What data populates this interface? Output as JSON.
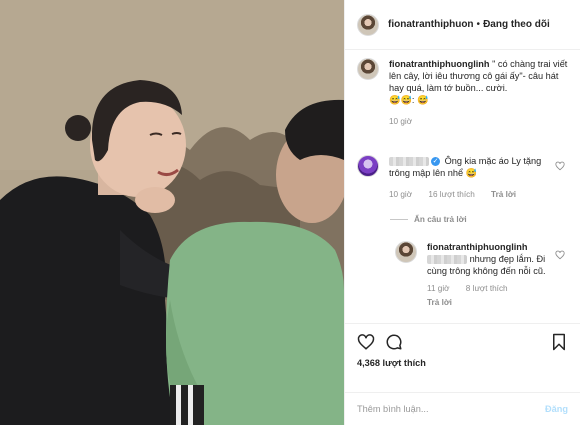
{
  "header": {
    "username": "fionatranthiphuon",
    "separator": "•",
    "follow_status": "Đang theo dõi"
  },
  "caption": {
    "username": "fionatranthiphuonglinh",
    "text": " \" có chàng trai viết lên cây, lời iêu thương cô gái ấy\"- câu hát hay quá, làm tớ buồn... cười.",
    "emoji_line": "😅😅: 😅",
    "time": "10 giờ"
  },
  "comment1": {
    "text": "Ông kia mặc áo Ly tặng trông mập lên nhể 😅",
    "time": "10 giờ",
    "likes": "16 lượt thích",
    "reply": "Trả lời",
    "hide_replies": "Ẩn câu trả lời"
  },
  "reply1": {
    "username": "fionatranthiphuonglinh",
    "text": "nhưng đẹp lắm. Đi cùng trông không đến nỗi cũ.",
    "time": "11 giờ",
    "likes": "8 lượt thích",
    "reply": "Trả lời"
  },
  "actions": {
    "likes_count": "4,368 lượt thích"
  },
  "add_comment": {
    "placeholder": "Thêm bình luận...",
    "post_label": "Đăng"
  },
  "colors": {
    "verified": "#3897f0",
    "muted": "#8e8e8e",
    "post_disabled": "#b2dffc"
  }
}
